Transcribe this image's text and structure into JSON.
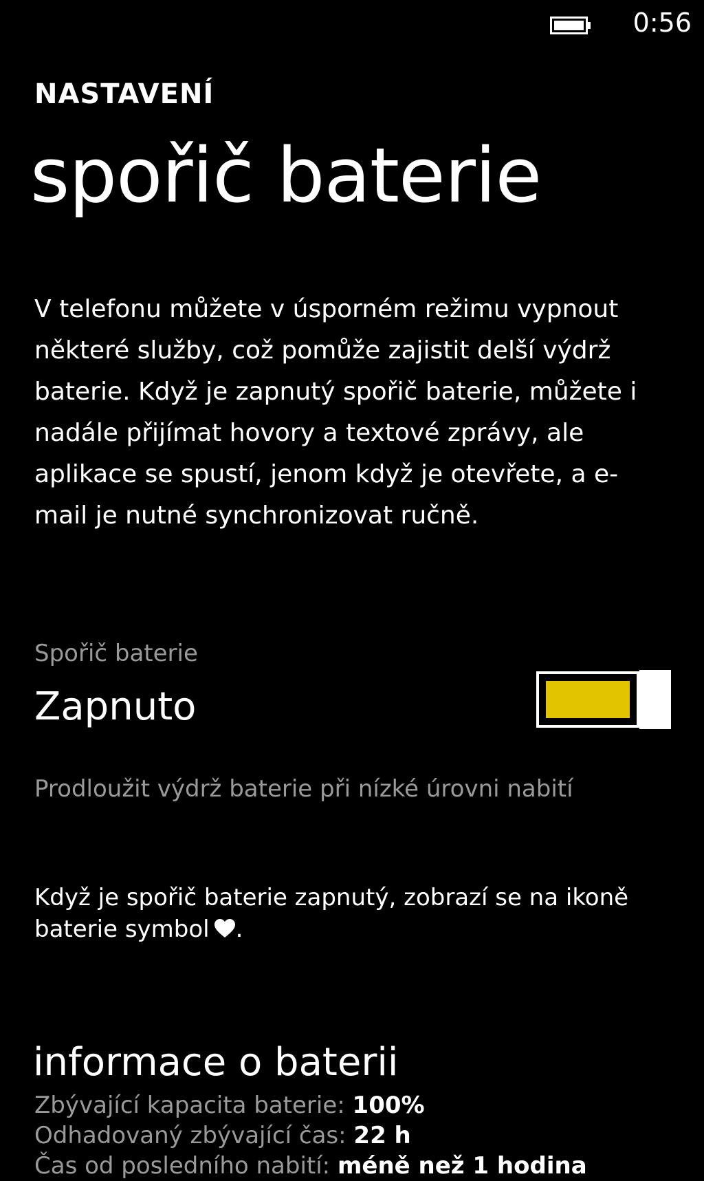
{
  "status_bar": {
    "battery_icon": "battery-icon",
    "time": "0:56"
  },
  "header": {
    "app_title": "NASTAVENÍ",
    "page_title": "spořič baterie"
  },
  "description": "V telefonu můžete v úsporném režimu vypnout některé služby, což pomůže zajistit delší výdrž baterie. Když je zapnutý spořič baterie, můžete i nadále přijímat hovory a textové zprávy, ale aplikace se spustí, jenom když je otevřete, a e-mail je nutné synchronizovat ručně.",
  "saver_toggle": {
    "header": "Spořič baterie",
    "state_label": "Zapnuto",
    "on": true,
    "accent_color": "#e3c400"
  },
  "extend_option": {
    "label": "Prodloužit výdrž baterie při nízké úrovni nabití"
  },
  "note": {
    "text": "Když je spořič baterie zapnutý, zobrazí se na ikoně baterie symbol",
    "icon": "heart-icon",
    "trailing": "."
  },
  "battery_info": {
    "title": "informace o baterii",
    "rows": [
      {
        "label": "Zbývající kapacita baterie:",
        "value": "100%"
      },
      {
        "label": "Odhadovaný zbývající čas:",
        "value": "22 h"
      },
      {
        "label": "Čas od posledního nabití:",
        "value": "méně než 1 hodina"
      }
    ]
  }
}
